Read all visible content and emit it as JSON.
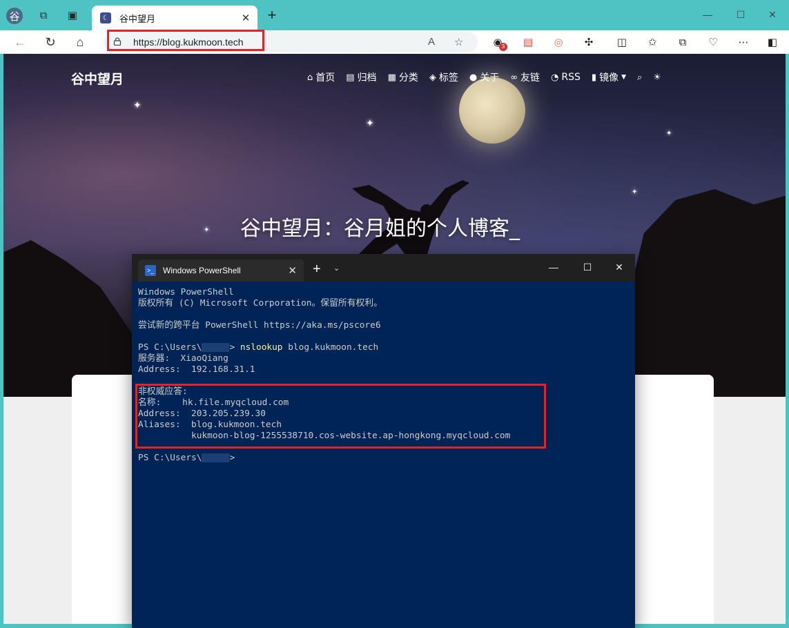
{
  "browser": {
    "profile_glyph": "谷",
    "tab": {
      "title": "谷中望月"
    },
    "url": "https://blog.kukmoon.tech",
    "extension_badge_count": "3"
  },
  "site": {
    "logo": "谷中望月",
    "nav": [
      {
        "icon": "home-icon",
        "label": "首页"
      },
      {
        "icon": "archive-icon",
        "label": "归档"
      },
      {
        "icon": "category-icon",
        "label": "分类"
      },
      {
        "icon": "tag-icon",
        "label": "标签"
      },
      {
        "icon": "user-icon",
        "label": "关于"
      },
      {
        "icon": "link-icon",
        "label": "友链"
      },
      {
        "icon": "rss-icon",
        "label": "RSS"
      },
      {
        "icon": "mirror-icon",
        "label": "镜像"
      }
    ],
    "hero_title": "谷中望月：谷月姐的个人博客_"
  },
  "powershell": {
    "window_title": "Windows PowerShell",
    "lines": {
      "l1": "Windows PowerShell",
      "l2": "版权所有 (C) Microsoft Corporation。保留所有权利。",
      "l4": "尝试新的跨平台 PowerShell https://aka.ms/pscore6",
      "prompt_prefix": "PS C:\\Users\\",
      "prompt_suffix": "> ",
      "command": "nslookup",
      "command_arg": " blog.kukmoon.tech",
      "server": "服务器:  XiaoQiang",
      "server_addr": "Address:  192.168.31.1",
      "nonauth": "非权威应答:",
      "name": "名称:    hk.file.myqcloud.com",
      "addr": "Address:  203.205.239.30",
      "aliases1": "Aliases:  blog.kukmoon.tech",
      "aliases2": "          kukmoon-blog-1255538710.cos-website.ap-hongkong.myqcloud.com",
      "prompt2_suffix": ">"
    }
  },
  "colors": {
    "browser_frame": "#4ec3c4",
    "ps_background": "#012456",
    "highlight": "#e0242c",
    "command": "#f9f1a5"
  }
}
